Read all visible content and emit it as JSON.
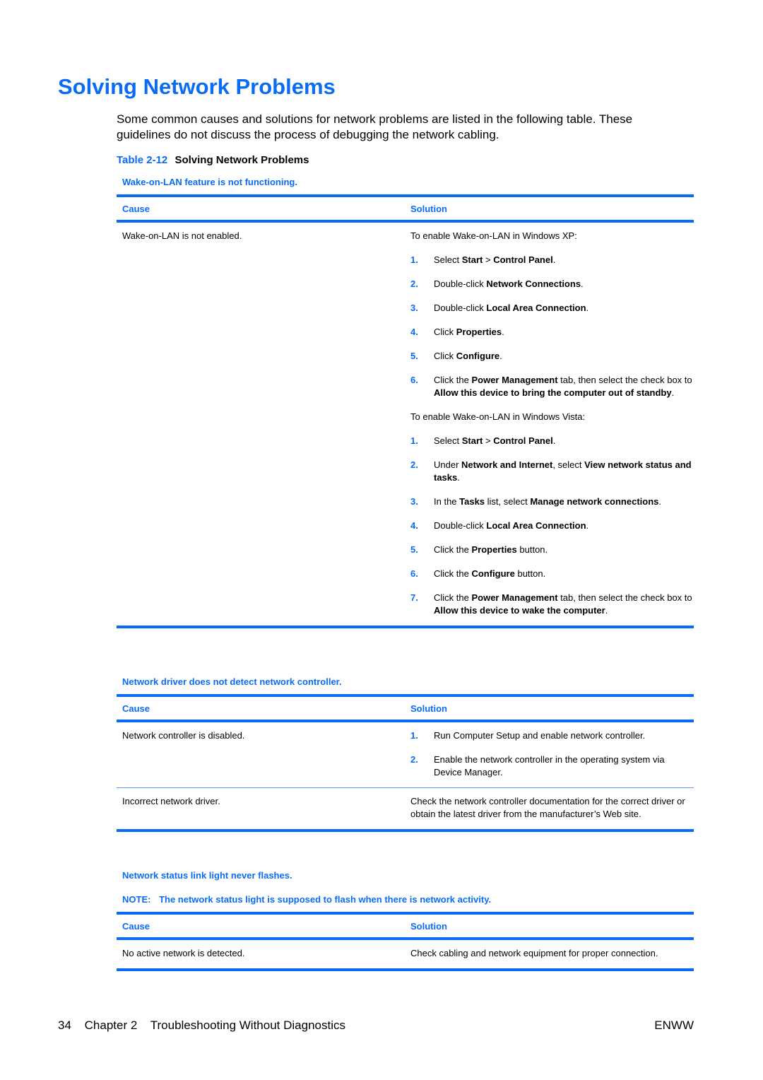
{
  "title": "Solving Network Problems",
  "intro": "Some common causes and solutions for network problems are listed in the following table. These guidelines do not discuss the process of debugging the network cabling.",
  "caption": {
    "number": "Table 2-12",
    "title": "Solving Network Problems"
  },
  "headers": {
    "cause": "Cause",
    "solution": "Solution"
  },
  "sections": [
    {
      "title": "Wake-on-LAN feature is not functioning.",
      "rows": [
        {
          "cause": "Wake-on-LAN is not enabled.",
          "solution_xp_intro": "To enable Wake-on-LAN in Windows XP:",
          "xp_steps": [
            {
              "n": "1.",
              "parts": [
                [
                  "",
                  "Select "
                ],
                [
                  "b",
                  "Start"
                ],
                [
                  "",
                  " > "
                ],
                [
                  "b",
                  "Control Panel"
                ],
                [
                  "",
                  "."
                ]
              ]
            },
            {
              "n": "2.",
              "parts": [
                [
                  "",
                  "Double-click "
                ],
                [
                  "b",
                  "Network Connections"
                ],
                [
                  "",
                  "."
                ]
              ]
            },
            {
              "n": "3.",
              "parts": [
                [
                  "",
                  "Double-click "
                ],
                [
                  "b",
                  "Local Area Connection"
                ],
                [
                  "",
                  "."
                ]
              ]
            },
            {
              "n": "4.",
              "parts": [
                [
                  "",
                  "Click "
                ],
                [
                  "b",
                  "Properties"
                ],
                [
                  "",
                  "."
                ]
              ]
            },
            {
              "n": "5.",
              "parts": [
                [
                  "",
                  "Click "
                ],
                [
                  "b",
                  "Configure"
                ],
                [
                  "",
                  "."
                ]
              ]
            },
            {
              "n": "6.",
              "parts": [
                [
                  "",
                  "Click the "
                ],
                [
                  "b",
                  "Power Management"
                ],
                [
                  "",
                  " tab, then select the check box to "
                ],
                [
                  "b",
                  "Allow this device to bring the computer out of standby"
                ],
                [
                  "",
                  "."
                ]
              ]
            }
          ],
          "solution_vista_intro": "To enable Wake-on-LAN in Windows Vista:",
          "vista_steps": [
            {
              "n": "1.",
              "parts": [
                [
                  "",
                  "Select "
                ],
                [
                  "b",
                  "Start"
                ],
                [
                  "",
                  " > "
                ],
                [
                  "b",
                  "Control Panel"
                ],
                [
                  "",
                  "."
                ]
              ]
            },
            {
              "n": "2.",
              "parts": [
                [
                  "",
                  "Under "
                ],
                [
                  "b",
                  "Network and Internet"
                ],
                [
                  "",
                  ", select "
                ],
                [
                  "b",
                  "View network status and tasks"
                ],
                [
                  "",
                  "."
                ]
              ]
            },
            {
              "n": "3.",
              "parts": [
                [
                  "",
                  "In the "
                ],
                [
                  "b",
                  "Tasks"
                ],
                [
                  "",
                  " list, select "
                ],
                [
                  "b",
                  "Manage network connections"
                ],
                [
                  "",
                  "."
                ]
              ]
            },
            {
              "n": "4.",
              "parts": [
                [
                  "",
                  "Double-click "
                ],
                [
                  "b",
                  "Local Area Connection"
                ],
                [
                  "",
                  "."
                ]
              ]
            },
            {
              "n": "5.",
              "parts": [
                [
                  "",
                  "Click the "
                ],
                [
                  "b",
                  "Properties"
                ],
                [
                  "",
                  " button."
                ]
              ]
            },
            {
              "n": "6.",
              "parts": [
                [
                  "",
                  "Click the "
                ],
                [
                  "b",
                  "Configure"
                ],
                [
                  "",
                  " button."
                ]
              ]
            },
            {
              "n": "7.",
              "parts": [
                [
                  "",
                  "Click the "
                ],
                [
                  "b",
                  "Power Management"
                ],
                [
                  "",
                  " tab, then select the check box to "
                ],
                [
                  "b",
                  "Allow this device to wake the computer"
                ],
                [
                  "",
                  "."
                ]
              ]
            }
          ]
        }
      ]
    },
    {
      "title": "Network driver does not detect network controller.",
      "rows": [
        {
          "cause": "Network controller is disabled.",
          "steps": [
            {
              "n": "1.",
              "text": "Run Computer Setup and enable network controller."
            },
            {
              "n": "2.",
              "text": "Enable the network controller in the operating system via Device Manager."
            }
          ]
        },
        {
          "cause": "Incorrect network driver.",
          "solution": "Check the network controller documentation for the correct driver or obtain the latest driver from the manufacturer’s Web site."
        }
      ]
    },
    {
      "title": "Network status link light never flashes.",
      "note_label": "NOTE:",
      "note": "The network status light is supposed to flash when there is network activity.",
      "rows": [
        {
          "cause": "No active network is detected.",
          "solution": "Check cabling and network equipment for proper connection."
        }
      ]
    }
  ],
  "footer": {
    "page": "34",
    "chapter": "Chapter 2",
    "chapter_title": "Troubleshooting Without Diagnostics",
    "locale": "ENWW"
  },
  "colors": {
    "accent": "#0a6cf5"
  }
}
